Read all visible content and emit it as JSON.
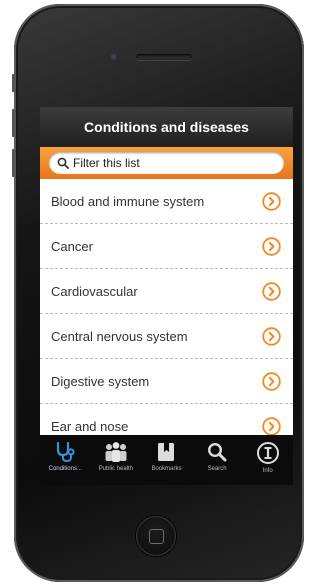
{
  "header": {
    "title": "Conditions and diseases"
  },
  "search": {
    "placeholder": "Filter this list"
  },
  "list": {
    "items": [
      {
        "label": "Blood and immune system"
      },
      {
        "label": "Cancer"
      },
      {
        "label": "Cardiovascular"
      },
      {
        "label": "Central nervous system"
      },
      {
        "label": "Digestive system"
      },
      {
        "label": "Ear and nose"
      }
    ]
  },
  "tabs": [
    {
      "label": "Conditions...",
      "icon": "stethoscope-icon",
      "active": true
    },
    {
      "label": "Public health",
      "icon": "people-icon",
      "active": false
    },
    {
      "label": "Bookmarks",
      "icon": "bookmarks-icon",
      "active": false
    },
    {
      "label": "Search",
      "icon": "search-icon",
      "active": false
    },
    {
      "label": "Info",
      "icon": "info-icon",
      "active": false
    }
  ],
  "colors": {
    "accent": "#f08a24",
    "titlebar": "#2a2a2a",
    "active_tab": "#3d8fd6"
  }
}
